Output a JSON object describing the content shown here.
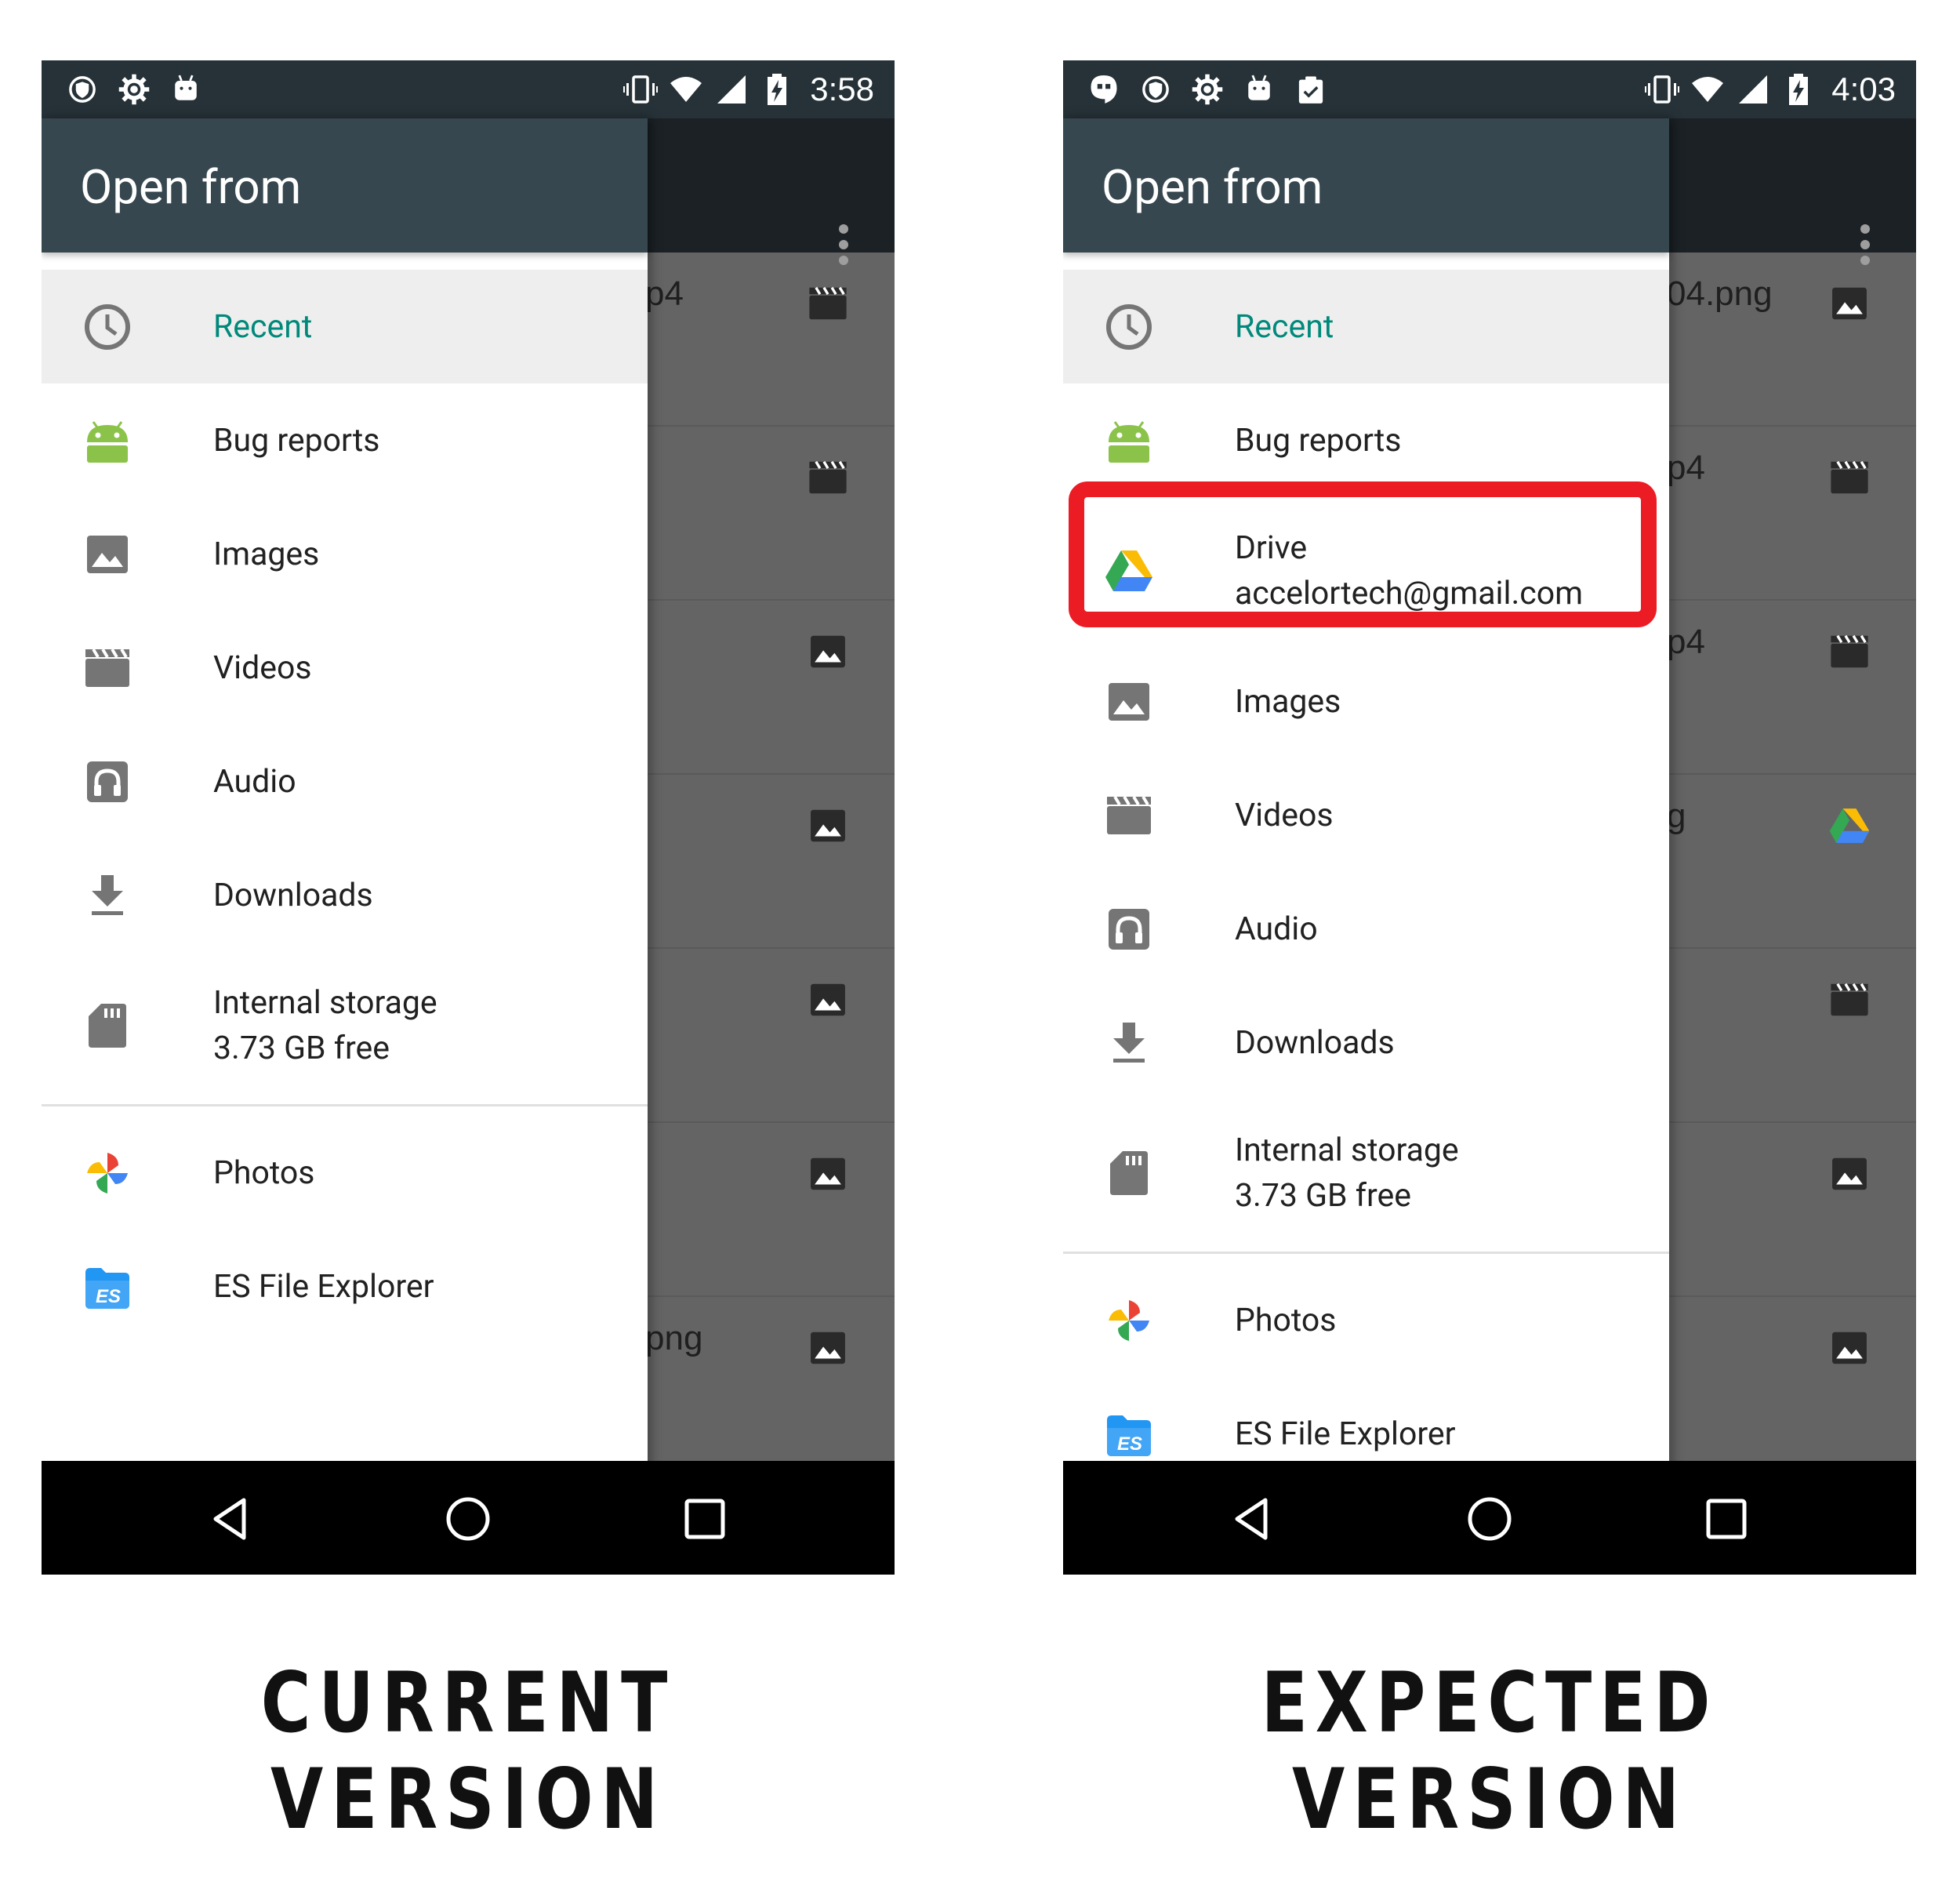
{
  "colors": {
    "statusbar": "#263238",
    "drawer_header": "#37474f",
    "accent": "#00897b",
    "highlight": "#ec1c24",
    "scrim": "#646464"
  },
  "left_phone": {
    "status_time": "3:58",
    "status_left_icons": [
      "vpn-shield-icon",
      "settings-gear-icon",
      "android-debug-icon"
    ],
    "title": "Open from",
    "items": [
      {
        "icon": "clock-icon",
        "label": "Recent",
        "active": true
      },
      {
        "icon": "android-icon",
        "label": "Bug reports"
      },
      {
        "icon": "image-icon",
        "label": "Images"
      },
      {
        "icon": "movie-icon",
        "label": "Videos"
      },
      {
        "icon": "audio-icon",
        "label": "Audio"
      },
      {
        "icon": "download-icon",
        "label": "Downloads"
      },
      {
        "icon": "sd-card-icon",
        "label": "Internal storage",
        "sub": "3.73 GB free"
      },
      {
        "icon": "photos-pinwheel-icon",
        "label": "Photos"
      },
      {
        "icon": "es-file-explorer-icon",
        "label": "ES File Explorer"
      }
    ],
    "bg_rows": [
      {
        "text": "p4",
        "icon": "movie-icon"
      },
      {
        "text": "",
        "icon": "movie-icon"
      },
      {
        "text": "",
        "icon": "image-icon"
      },
      {
        "text": "",
        "icon": "image-icon"
      },
      {
        "text": "",
        "icon": "image-icon"
      },
      {
        "text": "",
        "icon": "image-icon"
      },
      {
        "text": "png",
        "icon": "image-icon"
      }
    ],
    "caption": "CURRENT VERSION"
  },
  "right_phone": {
    "status_time": "4:03",
    "status_left_icons": [
      "hangouts-icon",
      "vpn-shield-icon",
      "settings-gear-icon",
      "android-debug-icon",
      "clipboard-check-icon"
    ],
    "title": "Open from",
    "items": [
      {
        "icon": "clock-icon",
        "label": "Recent",
        "active": true
      },
      {
        "icon": "android-icon",
        "label": "Bug reports"
      },
      {
        "icon": "google-drive-icon",
        "label": "Drive",
        "sub": "accelortech@gmail.com"
      },
      {
        "icon": "image-icon",
        "label": "Images"
      },
      {
        "icon": "movie-icon",
        "label": "Videos"
      },
      {
        "icon": "audio-icon",
        "label": "Audio"
      },
      {
        "icon": "download-icon",
        "label": "Downloads"
      },
      {
        "icon": "sd-card-icon",
        "label": "Internal storage",
        "sub": "3.73 GB free"
      },
      {
        "icon": "photos-pinwheel-icon",
        "label": "Photos"
      },
      {
        "icon": "es-file-explorer-icon",
        "label": "ES File Explorer"
      }
    ],
    "bg_rows": [
      {
        "text": "04.png",
        "icon": "image-icon"
      },
      {
        "text": "p4",
        "icon": "movie-icon"
      },
      {
        "text": "p4",
        "icon": "movie-icon"
      },
      {
        "text": "g",
        "icon": "google-drive-icon"
      },
      {
        "text": "",
        "icon": "movie-icon"
      },
      {
        "text": "",
        "icon": "image-icon"
      },
      {
        "text": "",
        "icon": "image-icon"
      }
    ],
    "caption": "EXPECTED VERSION"
  }
}
